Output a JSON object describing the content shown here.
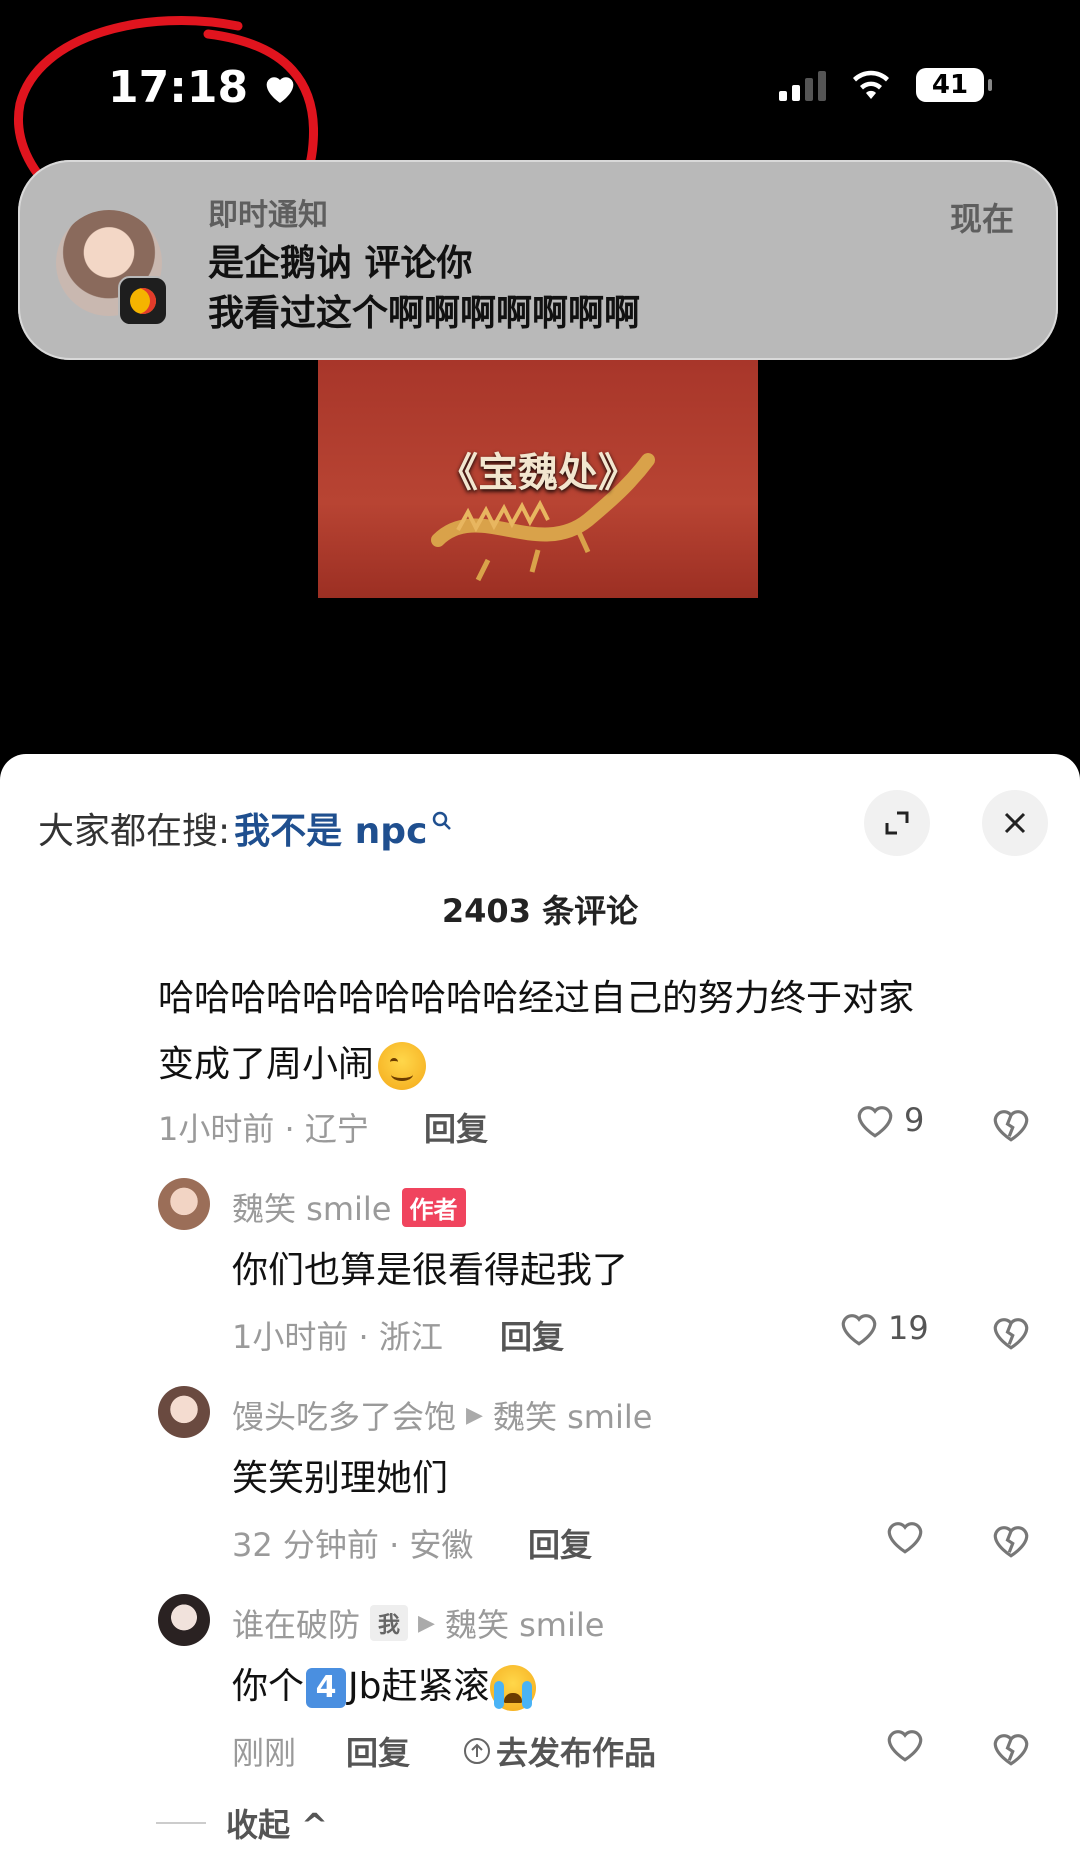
{
  "status_bar": {
    "time": "17:18",
    "battery": "41"
  },
  "notification": {
    "kind": "即时通知",
    "title": "是企鹅讷 评论你",
    "body": "我看过这个啊啊啊啊啊啊啊",
    "time": "现在"
  },
  "video": {
    "title": "《宝魏处》"
  },
  "sheet": {
    "search_prefix": "大家都在搜:",
    "search_term": "我不是 npc",
    "comment_count": "2403 条评论"
  },
  "comments": [
    {
      "text_line1": "哈哈哈哈哈哈哈哈哈哈经过自己的努力终于对家",
      "text_line2": "变成了周小闹",
      "meta": "1小时前 · 辽宁",
      "reply": "回复",
      "likes": "9"
    },
    {
      "username": "魏笑 smile",
      "badge": "作者",
      "text": "你们也算是很看得起我了",
      "meta": "1小时前 · 浙江",
      "reply": "回复",
      "likes": "19"
    },
    {
      "username": "馒头吃多了会饱",
      "reply_to": "魏笑 smile",
      "text": "笑笑别理她们",
      "meta": "32 分钟前 · 安徽",
      "reply": "回复"
    },
    {
      "username": "谁在破防",
      "badge": "我",
      "reply_to": "魏笑 smile",
      "text_before": "你个",
      "keycap": "4",
      "text_after": "Jb赶紧滚",
      "meta": "刚刚",
      "reply": "回复",
      "publish": "去发布作品"
    }
  ],
  "collapse_label": "收起 ^"
}
